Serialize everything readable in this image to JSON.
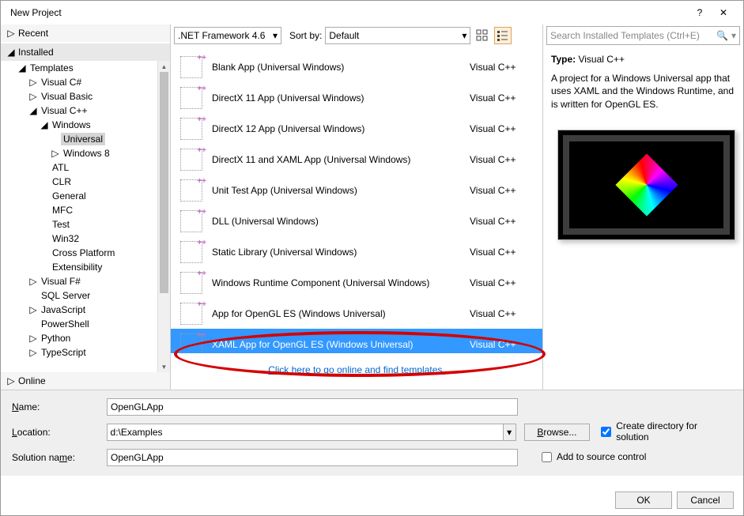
{
  "window": {
    "title": "New Project"
  },
  "toolbar": {
    "framework": ".NET Framework 4.6",
    "sortby_label": "Sort by:",
    "sort_value": "Default"
  },
  "left": {
    "recent": "Recent",
    "installed": "Installed",
    "online": "Online",
    "tree": {
      "templates": "Templates",
      "vcs": "Visual C#",
      "vb": "Visual Basic",
      "vcpp": "Visual C++",
      "windows": "Windows",
      "universal": "Universal",
      "win8": "Windows 8",
      "atl": "ATL",
      "clr": "CLR",
      "general": "General",
      "mfc": "MFC",
      "test": "Test",
      "win32": "Win32",
      "xplat": "Cross Platform",
      "ext": "Extensibility",
      "vfs": "Visual F#",
      "sql": "SQL Server",
      "js": "JavaScript",
      "ps": "PowerShell",
      "py": "Python",
      "ts": "TypeScript"
    }
  },
  "templates": [
    {
      "name": "Blank App (Universal Windows)",
      "lang": "Visual C++"
    },
    {
      "name": "DirectX 11 App (Universal Windows)",
      "lang": "Visual C++"
    },
    {
      "name": "DirectX 12 App (Universal Windows)",
      "lang": "Visual C++"
    },
    {
      "name": "DirectX 11 and XAML App (Universal Windows)",
      "lang": "Visual C++"
    },
    {
      "name": "Unit Test App (Universal Windows)",
      "lang": "Visual C++"
    },
    {
      "name": "DLL (Universal Windows)",
      "lang": "Visual C++"
    },
    {
      "name": "Static Library (Universal Windows)",
      "lang": "Visual C++"
    },
    {
      "name": "Windows Runtime Component (Universal Windows)",
      "lang": "Visual C++"
    },
    {
      "name": "App for OpenGL ES (Windows Universal)",
      "lang": "Visual C++"
    },
    {
      "name": "XAML App for OpenGL ES (Windows Universal)",
      "lang": "Visual C++"
    }
  ],
  "online_link": "Click here to go online and find templates.",
  "right": {
    "search_placeholder": "Search Installed Templates (Ctrl+E)",
    "type_label": "Type:",
    "type_value": "Visual C++",
    "desc": "A project for a Windows Universal app that uses XAML and the Windows Runtime, and is written for OpenGL ES."
  },
  "form": {
    "name_label": "Name:",
    "name_value": "OpenGLApp",
    "loc_label": "Location:",
    "loc_value": "d:\\Examples",
    "sol_label": "Solution name:",
    "sol_value": "OpenGLApp",
    "browse": "Browse...",
    "chk1": "Create directory for solution",
    "chk2": "Add to source control"
  },
  "buttons": {
    "ok": "OK",
    "cancel": "Cancel"
  }
}
